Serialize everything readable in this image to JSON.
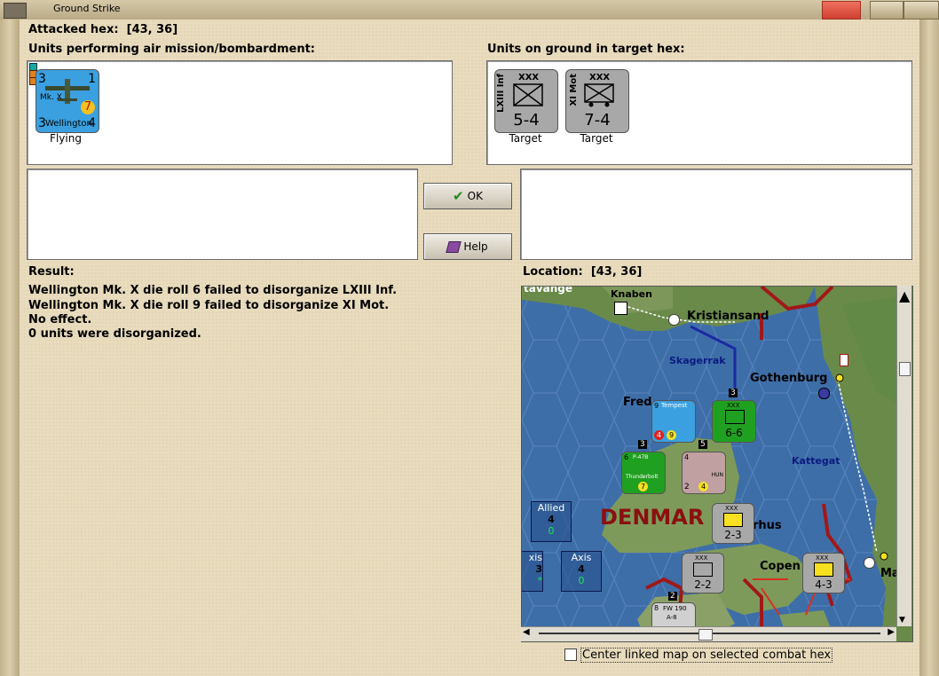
{
  "window": {
    "title": "Ground Strike"
  },
  "attacked_hex": {
    "label": "Attacked hex:",
    "value": "[43, 36]"
  },
  "air_units": {
    "heading": "Units performing air mission/bombardment:",
    "items": [
      {
        "name": "Wellington",
        "model": "Mk. X",
        "top_left": "3",
        "top_right": "1",
        "bottom_left": "3",
        "bottom_right": "4",
        "badge": "7",
        "status": "Flying",
        "color": "#3aa0e0"
      }
    ]
  },
  "ground_units": {
    "heading": "Units on ground in target hex:",
    "items": [
      {
        "name": "LXIII Inf",
        "size": "XXX",
        "strength": "5-4",
        "status": "Target"
      },
      {
        "name": "XI Mot",
        "size": "XXX",
        "strength": "7-4",
        "status": "Target"
      }
    ]
  },
  "buttons": {
    "ok": "OK",
    "help": "Help"
  },
  "result": {
    "heading": "Result:",
    "lines": [
      "Wellington Mk. X die roll 6 failed to disorganize LXIII Inf.",
      "Wellington Mk. X die roll 9 failed to disorganize XI Mot.",
      "No effect.",
      "0 units were disorganized."
    ]
  },
  "location": {
    "label": "Location:",
    "value": "[43, 36]"
  },
  "map": {
    "places": {
      "stavanger": "tavange",
      "knaben": "Knaben",
      "kristiansand": "Kristiansand",
      "skagerrak": "Skagerrak",
      "gothenburg": "Gothenburg",
      "frederikshavn": "Fred",
      "kattegat": "Kattegat",
      "denmark": "DENMAR",
      "aarhus": "rhus",
      "copenhagen": "Copen",
      "malmo": "Ma"
    },
    "stacks": {
      "tempest": {
        "name": "Tempest",
        "left": "9",
        "a": "4",
        "b": "9"
      },
      "xxx_green": {
        "size": "XXX",
        "strength": "6-6"
      },
      "p47": {
        "name": "P-47B",
        "sub": "Thunderbolt",
        "left": "6",
        "badge": "7"
      },
      "ju": {
        "left": "4",
        "a": "2",
        "b": "4",
        "side": "HUN"
      },
      "xxx_yellow1": {
        "size": "XXX",
        "strength": "2-3"
      },
      "xxx_gray": {
        "size": "XXX",
        "strength": "2-2"
      },
      "xxx_yellow2": {
        "size": "XXX",
        "strength": "4-3"
      },
      "fw190": {
        "name": "FW 190",
        "sub": "A-8",
        "left": "8"
      },
      "stack_tags": [
        "3",
        "3",
        "5",
        "2"
      ]
    },
    "boxes": {
      "allied": {
        "label": "Allied",
        "count": "4",
        "zero": "0"
      },
      "axis1": {
        "label": "xis",
        "count": "3",
        "zero": "*"
      },
      "axis2": {
        "label": "Axis",
        "count": "4",
        "zero": "0"
      }
    }
  },
  "center_checkbox": {
    "label": "Center linked map on selected combat hex",
    "checked": false
  },
  "colors": {
    "frame": "#e9dcbe",
    "sea": "#3e6ea8",
    "land": "#6a8a4a",
    "border_red": "#a01818"
  }
}
